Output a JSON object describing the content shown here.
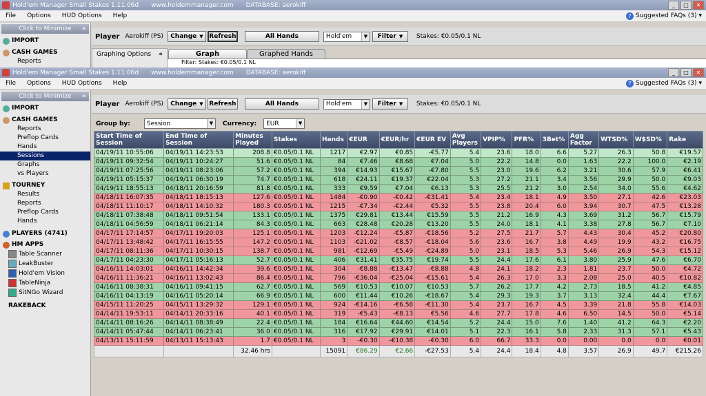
{
  "app": {
    "title": "Hold'em Manager Small Stakes 1.11.06d",
    "website": "www.holdemmanager.com",
    "database": "DATABASE: aerokiff"
  },
  "menu": [
    "File",
    "Options",
    "HUD Options",
    "Help"
  ],
  "faq_label": "Suggested FAQs (3)",
  "sidebar": {
    "minimize_label": "Click to Minimize",
    "minimize_chev": "«",
    "import_label": "IMPORT",
    "cash_label": "CASH GAMES",
    "cash_items": [
      "Reports",
      "Preflop Cards",
      "Hands",
      "Sessions",
      "Graphs",
      "vs Players"
    ],
    "tourney_label": "TOURNEY",
    "tourney_items": [
      "Results",
      "Reports",
      "Preflop Cards",
      "Hands"
    ],
    "players_label": "PLAYERS (4741)",
    "apps_label": "HM APPS",
    "apps": [
      "Table Scanner",
      "LeakBuster",
      "Hold'em Vision",
      "TableNinja",
      "SitNGo Wizard"
    ],
    "rakeback_label": "RAKEBACK"
  },
  "back_window": {
    "reports_partial": "Reports",
    "graphing_options": "Graphing Options",
    "tab_graph": "Graph",
    "tab_graphed_hands": "Graphed Hands",
    "filter_text": "Filter: Stakes: €0.05/0.1 NL"
  },
  "toolbar": {
    "player_label": "Player",
    "player_name": "Aerokiff (PS)",
    "change_label": "Change",
    "refresh_label": "Refresh",
    "all_hands_label": "All Hands",
    "game_value": "Hold'em",
    "filter_label": "Filter",
    "stakes_text": "Stakes: €0.05/0.1 NL"
  },
  "groupby": {
    "label": "Group by:",
    "value": "Session",
    "currency_label": "Currency:",
    "currency_value": "EUR"
  },
  "table": {
    "columns": [
      "Start Time of Session",
      "End Time of Session",
      "Minutes Played",
      "Stakes",
      "Hands",
      "€EUR",
      "€EUR/hr",
      "€EUR EV",
      "Avg Players",
      "VPIP%",
      "PFR%",
      "3Bet%",
      "Agg Factor",
      "WTSD%",
      "W$SD%",
      "Rake"
    ],
    "rows": [
      [
        "04/19/11 10:55:06",
        "04/19/11 14:23:53",
        "208.8",
        "€0.05/0.1 NL",
        "1217",
        "€2.97",
        "€0.85",
        "-€5.77",
        "5.4",
        "23.6",
        "18.0",
        "6.6",
        "5.27",
        "26.3",
        "50.8",
        "€19.57"
      ],
      [
        "04/19/11 09:32:54",
        "04/19/11 10:24:27",
        "51.6",
        "€0.05/0.1 NL",
        "84",
        "€7.46",
        "€8.68",
        "€7.04",
        "5.0",
        "22.2",
        "14.8",
        "0.0",
        "1.63",
        "22.2",
        "100.0",
        "€2.19"
      ],
      [
        "04/19/11 07:25:56",
        "04/19/11 08:23:06",
        "57.2",
        "€0.05/0.1 NL",
        "394",
        "€14.93",
        "€15.67",
        "-€7.80",
        "5.5",
        "23.0",
        "19.6",
        "6.2",
        "3.21",
        "30.6",
        "57.9",
        "€6.41"
      ],
      [
        "04/19/11 05:15:37",
        "04/19/11 06:30:19",
        "74.7",
        "€0.05/0.1 NL",
        "618",
        "€24.11",
        "€19.37",
        "€22.04",
        "5.3",
        "27.2",
        "21.1",
        "3.4",
        "3.56",
        "29.9",
        "50.0",
        "€9.03"
      ],
      [
        "04/19/11 18:55:13",
        "04/18/11 20:16:59",
        "81.8",
        "€0.05/0.1 NL",
        "333",
        "€9.59",
        "€7.04",
        "€6.13",
        "5.3",
        "25.5",
        "21.2",
        "3.0",
        "2.54",
        "34.0",
        "55.6",
        "€4.62"
      ],
      [
        "04/18/11 16:07:35",
        "04/18/11 18:15:13",
        "127.6",
        "€0.05/0.1 NL",
        "1484",
        "-€0.90",
        "-€0.42",
        "-€31.41",
        "5.4",
        "23.4",
        "18.1",
        "4.9",
        "3.50",
        "27.1",
        "42.6",
        "€23.03"
      ],
      [
        "04/18/11 11:10:17",
        "04/18/11 14:10:32",
        "180.3",
        "€0.05/0.1 NL",
        "1215",
        "-€7.34",
        "-€2.44",
        "€5.32",
        "5.5",
        "23.8",
        "20.4",
        "6.0",
        "3.94",
        "30.7",
        "47.5",
        "€13.28"
      ],
      [
        "04/18/11 07:38:48",
        "04/18/11 09:51:54",
        "133.1",
        "€0.05/0.1 NL",
        "1375",
        "€29.81",
        "€13.44",
        "€15.59",
        "5.5",
        "21.2",
        "16.9",
        "4.3",
        "3.69",
        "31.2",
        "56.7",
        "€15.79"
      ],
      [
        "04/18/11 04:56:59",
        "04/18/11 06:21:14",
        "84.3",
        "€0.05/0.1 NL",
        "663",
        "€28.48",
        "€20.28",
        "€13.20",
        "5.5",
        "24.0",
        "18.1",
        "4.1",
        "3.38",
        "27.8",
        "56.7",
        "€7.10"
      ],
      [
        "04/17/11 17:14:57",
        "04/17/11 19:20:03",
        "125.1",
        "€0.05/0.1 NL",
        "1203",
        "-€12.24",
        "-€5.87",
        "-€18.56",
        "5.2",
        "27.5",
        "21.7",
        "5.7",
        "4.43",
        "30.4",
        "45.2",
        "€20.80"
      ],
      [
        "04/17/11 13:48:42",
        "04/17/11 16:15:55",
        "147.2",
        "€0.05/0.1 NL",
        "1103",
        "-€21.02",
        "-€8.57",
        "-€18.04",
        "5.6",
        "23.6",
        "16.7",
        "3.8",
        "4.49",
        "19.9",
        "43.2",
        "€16.75"
      ],
      [
        "04/17/11 08:11:36",
        "04/17/11 10:30:15",
        "138.7",
        "€0.05/0.1 NL",
        "981",
        "-€12.69",
        "-€5.49",
        "-€24.89",
        "5.0",
        "23.1",
        "18.5",
        "5.3",
        "5.46",
        "26.9",
        "54.3",
        "€15.12"
      ],
      [
        "04/17/11 04:23:30",
        "04/17/11 05:16:13",
        "52.7",
        "€0.05/0.1 NL",
        "406",
        "€31.41",
        "€35.75",
        "€19.74",
        "5.5",
        "24.4",
        "17.6",
        "6.1",
        "3.80",
        "25.9",
        "47.6",
        "€6.70"
      ],
      [
        "04/16/11 14:03:01",
        "04/16/11 14:42:34",
        "39.6",
        "€0.05/0.1 NL",
        "304",
        "-€8.88",
        "-€13.47",
        "-€8.88",
        "4.8",
        "24.1",
        "18.2",
        "2.3",
        "1.81",
        "23.7",
        "50.0",
        "€4.72"
      ],
      [
        "04/16/11 11:36:21",
        "04/16/11 13:02:43",
        "86.4",
        "€0.05/0.1 NL",
        "796",
        "-€36.04",
        "-€25.04",
        "-€15.61",
        "5.4",
        "26.3",
        "17.0",
        "3.3",
        "2.08",
        "25.0",
        "40.5",
        "€10.82"
      ],
      [
        "04/16/11 08:38:31",
        "04/16/11 09:41:15",
        "62.7",
        "€0.05/0.1 NL",
        "569",
        "€10.53",
        "€10.07",
        "€10.53",
        "5.7",
        "26.2",
        "17.7",
        "4.2",
        "2.73",
        "18.5",
        "41.2",
        "€4.85"
      ],
      [
        "04/16/11 04:13:19",
        "04/16/11 05:20:14",
        "66.9",
        "€0.05/0.1 NL",
        "600",
        "€11.44",
        "€10.26",
        "-€18.67",
        "5.4",
        "29.3",
        "19.3",
        "3.7",
        "3.13",
        "32.4",
        "44.4",
        "€7.67"
      ],
      [
        "04/15/11 11:20:25",
        "04/15/11 13:29:32",
        "129.1",
        "€0.05/0.1 NL",
        "924",
        "-€14.16",
        "-€6.58",
        "-€11.30",
        "5.4",
        "23.7",
        "16.7",
        "4.5",
        "3.39",
        "21.8",
        "55.8",
        "€14.03"
      ],
      [
        "04/14/11 19:53:11",
        "04/14/11 20:33:16",
        "40.1",
        "€0.05/0.1 NL",
        "319",
        "-€5.43",
        "-€8.13",
        "€5.56",
        "4.6",
        "27.7",
        "17.8",
        "4.6",
        "6.50",
        "14.5",
        "50.0",
        "€5.14"
      ],
      [
        "04/14/11 08:16:26",
        "04/14/11 08:38:49",
        "22.4",
        "€0.05/0.1 NL",
        "184",
        "€16.64",
        "€44.60",
        "€14.54",
        "5.2",
        "24.4",
        "15.0",
        "7.6",
        "1.40",
        "41.2",
        "64.3",
        "€2.20"
      ],
      [
        "04/14/11 05:47:44",
        "04/14/11 06:23:41",
        "36.0",
        "€0.05/0.1 NL",
        "316",
        "€17.92",
        "€29.91",
        "€14.01",
        "5.1",
        "22.3",
        "16.1",
        "5.8",
        "2.33",
        "31.3",
        "57.1",
        "€5.43"
      ],
      [
        "04/13/11 15:11:59",
        "04/13/11 15:13:43",
        "1.7",
        "€0.05/0.1 NL",
        "3",
        "-€0.30",
        "-€10.38",
        "-€0.30",
        "6.0",
        "66.7",
        "33.3",
        "0.0",
        "0.00",
        "0.0",
        "0.0",
        "€0.01"
      ]
    ],
    "totals": [
      "",
      "",
      "32.46 hrs",
      "",
      "15091",
      "€86.29",
      "€2.66",
      "-€27.53",
      "5.4",
      "24.4",
      "18.4",
      "4.8",
      "3.57",
      "26.9",
      "49.7",
      "€215.26"
    ]
  }
}
